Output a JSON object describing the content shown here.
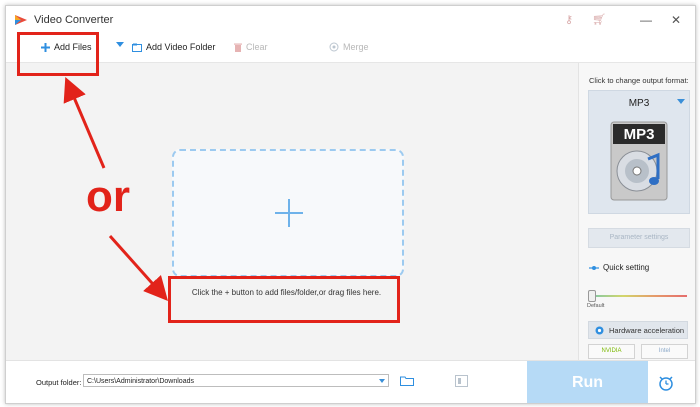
{
  "window": {
    "title": "Video Converter"
  },
  "toolbar": {
    "add_files": "Add Files",
    "add_video_folder": "Add Video Folder",
    "clear": "Clear",
    "merge": "Merge"
  },
  "main": {
    "hint": "Click the + button to add files/folder,or drag files here."
  },
  "panel": {
    "format_prompt": "Click to change output format:",
    "format_selected": "MP3",
    "format_icon_label": "MP3",
    "parameter_settings": "Parameter settings",
    "quick_setting": "Quick setting",
    "slider_default_label": "Default",
    "hardware_acceleration": "Hardware acceleration",
    "nvidia_label": "NVIDIA",
    "intel_label": "Intel"
  },
  "bottom": {
    "output_folder_label": "Output folder:",
    "output_folder_value": "C:\\Users\\Administrator\\Downloads",
    "run_label": "Run"
  },
  "annotation": {
    "or_text": "or",
    "color": "#e2231a"
  },
  "colors": {
    "accent_blue": "#3a8fd8",
    "run_button": "#b6daf6",
    "dropzone_border": "#9ccaf0"
  }
}
